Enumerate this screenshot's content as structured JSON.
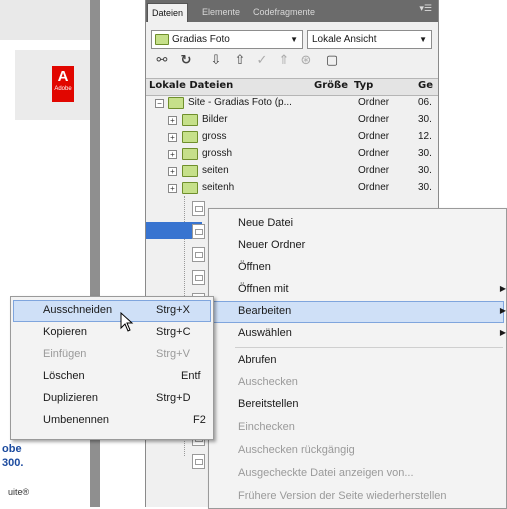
{
  "background": {
    "brand": "Adobe",
    "blue_text_1": "obe",
    "blue_text_2": "300.",
    "suite_text": "uite®"
  },
  "panel": {
    "tabs": [
      "Dateien",
      "Elemente",
      "Codefragmente"
    ],
    "site_select": "Gradias Foto",
    "view_select": "Lokale Ansicht",
    "toolbar_icons": [
      "connect-icon",
      "refresh-icon",
      "get-files-icon",
      "put-files-icon",
      "checkout-icon",
      "checkin-icon",
      "sync-icon",
      "expand-icon"
    ],
    "columns": {
      "name": "Lokale Dateien",
      "size": "Größe",
      "type": "Typ",
      "modified": "Ge"
    },
    "rows": [
      {
        "name": "Site - Gradias Foto (p...",
        "type": "Ordner",
        "date": "06."
      },
      {
        "name": "Bilder",
        "type": "Ordner",
        "date": "30."
      },
      {
        "name": "gross",
        "type": "Ordner",
        "date": "12."
      },
      {
        "name": "grossh",
        "type": "Ordner",
        "date": "30."
      },
      {
        "name": "seiten",
        "type": "Ordner",
        "date": "30."
      },
      {
        "name": "seitenh",
        "type": "Ordner",
        "date": "30."
      }
    ]
  },
  "context_menu": {
    "items": [
      {
        "label": "Neue Datei",
        "disabled": false
      },
      {
        "label": "Neuer Ordner",
        "disabled": false
      },
      {
        "label": "Öffnen",
        "disabled": false
      },
      {
        "label": "Öffnen mit",
        "disabled": false,
        "submenu": true
      },
      {
        "label": "Bearbeiten",
        "disabled": false,
        "submenu": true
      },
      {
        "label": "Auswählen",
        "disabled": false,
        "submenu": true
      },
      {
        "label": "Abrufen",
        "disabled": false
      },
      {
        "label": "Auschecken",
        "disabled": true
      },
      {
        "label": "Bereitstellen",
        "disabled": false
      },
      {
        "label": "Einchecken",
        "disabled": true
      },
      {
        "label": "Auschecken rückgängig",
        "disabled": true
      },
      {
        "label": "Ausgecheckte Datei anzeigen von...",
        "disabled": true
      },
      {
        "label": "Frühere Version der Seite wiederherstellen",
        "disabled": true
      }
    ]
  },
  "edit_submenu": {
    "items": [
      {
        "label": "Ausschneiden",
        "shortcut": "Strg+X",
        "disabled": false
      },
      {
        "label": "Kopieren",
        "shortcut": "Strg+C",
        "disabled": false
      },
      {
        "label": "Einfügen",
        "shortcut": "Strg+V",
        "disabled": true
      },
      {
        "label": "Löschen",
        "shortcut": "Entf",
        "disabled": false
      },
      {
        "label": "Duplizieren",
        "shortcut": "Strg+D",
        "disabled": false
      },
      {
        "label": "Umbenennen",
        "shortcut": "F2",
        "disabled": false
      }
    ]
  },
  "colors": {
    "selection": "#3874d0",
    "highlight": "#cfe0f7",
    "folder": "#c6e08a",
    "adobe_red": "#e10600"
  }
}
